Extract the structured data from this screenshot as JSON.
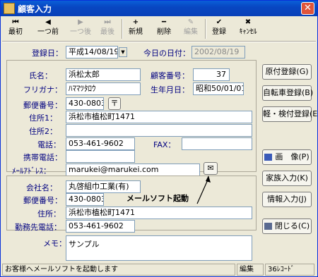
{
  "window": {
    "title": "顧客入力",
    "close_glyph": "✕"
  },
  "toolbar": {
    "first": {
      "icon": "⏮",
      "label": "最初"
    },
    "prev": {
      "icon": "◀",
      "label": "一つ前"
    },
    "next": {
      "icon": "▶",
      "label": "一つ後"
    },
    "last": {
      "icon": "⏭",
      "label": "最後"
    },
    "new": {
      "icon": "+",
      "label": "新規"
    },
    "delete": {
      "icon": "━",
      "label": "削除"
    },
    "edit": {
      "icon": "✎",
      "label": "編集"
    },
    "register": {
      "icon": "✔",
      "label": "登録"
    },
    "cancel": {
      "icon": "✖",
      "label": "ｷｬﾝｾﾙ"
    }
  },
  "header": {
    "reg_date_label": "登録日：",
    "reg_date_value": "平成14/08/19",
    "today_label": "今日の日付：",
    "today_value": "2002/08/19"
  },
  "customer": {
    "name_label": "氏名：",
    "name_value": "浜松太郎",
    "cust_no_label": "顧客番号：",
    "cust_no_value": "37",
    "furigana_label": "フリガナ：",
    "furigana_value": "ﾊﾏﾏﾂﾀﾛｳ",
    "birth_label": "生年月日：",
    "birth_value": "昭和50/01/01",
    "postal_label": "郵便番号：",
    "postal_value": "430-0803",
    "postal_btn": "〒",
    "addr1_label": "住所1：",
    "addr1_value": "浜松市植松町1471",
    "addr2_label": "住所2：",
    "addr2_value": "",
    "tel_label": "電話：",
    "tel_value": "053-461-9602",
    "fax_label": "FAX：",
    "fax_value": "",
    "mobile_label": "携帯電話：",
    "mobile_value": "",
    "mail_label": "ﾒｰﾙｱﾄﾞﾚｽ：",
    "mail_value": "marukei@marukei.com",
    "mail_btn_icon": "✉"
  },
  "company": {
    "name_label": "会社名：",
    "name_value": "丸啓組巾工業(有)",
    "postal_label": "郵便番号：",
    "postal_value": "430-0803",
    "addr_label": "住所：",
    "addr_value": "浜松市植松町1471",
    "tel_label": "勤務先電話：",
    "tel_value": "053-461-9602"
  },
  "annotation": "メールソフト起動",
  "side_buttons": {
    "genpu": "原付登録(G)",
    "jitensha": "自転車登録(B)",
    "kei": "軽・検付登録(E)",
    "gazo": "画　像(P)",
    "kazoku": "家族入力(K)",
    "joho": "情報入力(J)",
    "close": "閉じる(C)"
  },
  "memo": {
    "label": "メモ：",
    "value": "サンプル"
  },
  "status": {
    "message": "お客様へメールソフトを起動します",
    "mode": "編集",
    "records": "36ﾚｺｰﾄﾞ"
  }
}
